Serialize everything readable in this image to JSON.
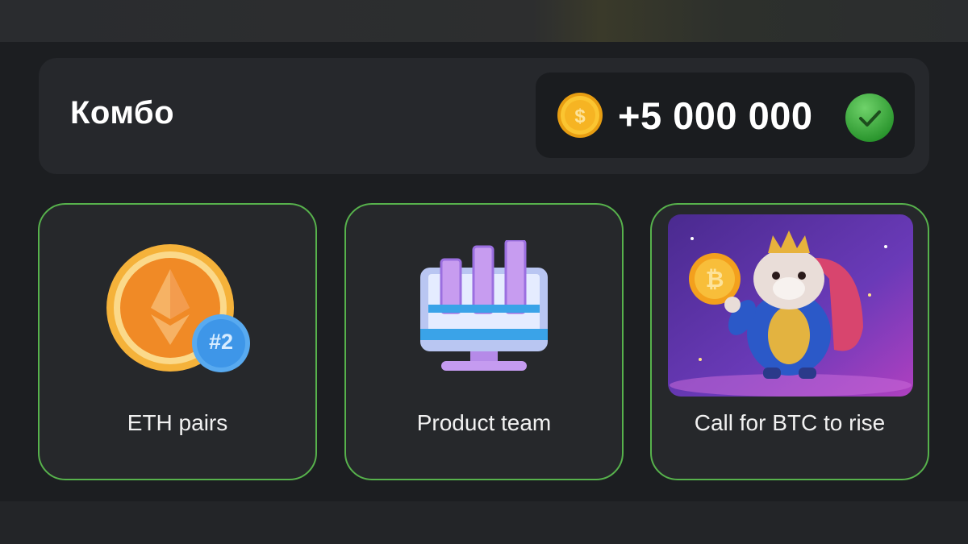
{
  "combo": {
    "title": "Комбо",
    "reward_amount": "+5 000 000",
    "reward_icon": "gold-coin-icon",
    "status_icon": "checkmark-icon"
  },
  "cards": [
    {
      "label": "ETH pairs",
      "icon": "ethereum-coin-icon",
      "badge": "#2"
    },
    {
      "label": "Product team",
      "icon": "bar-chart-monitor-icon"
    },
    {
      "label": "Call for BTC to rise",
      "icon": "hamster-king-illustration"
    }
  ],
  "colors": {
    "card_border": "#57b24c",
    "background": "#1c1e21",
    "accent_gold": "#f5b51c",
    "check_green": "#3fa83f"
  }
}
